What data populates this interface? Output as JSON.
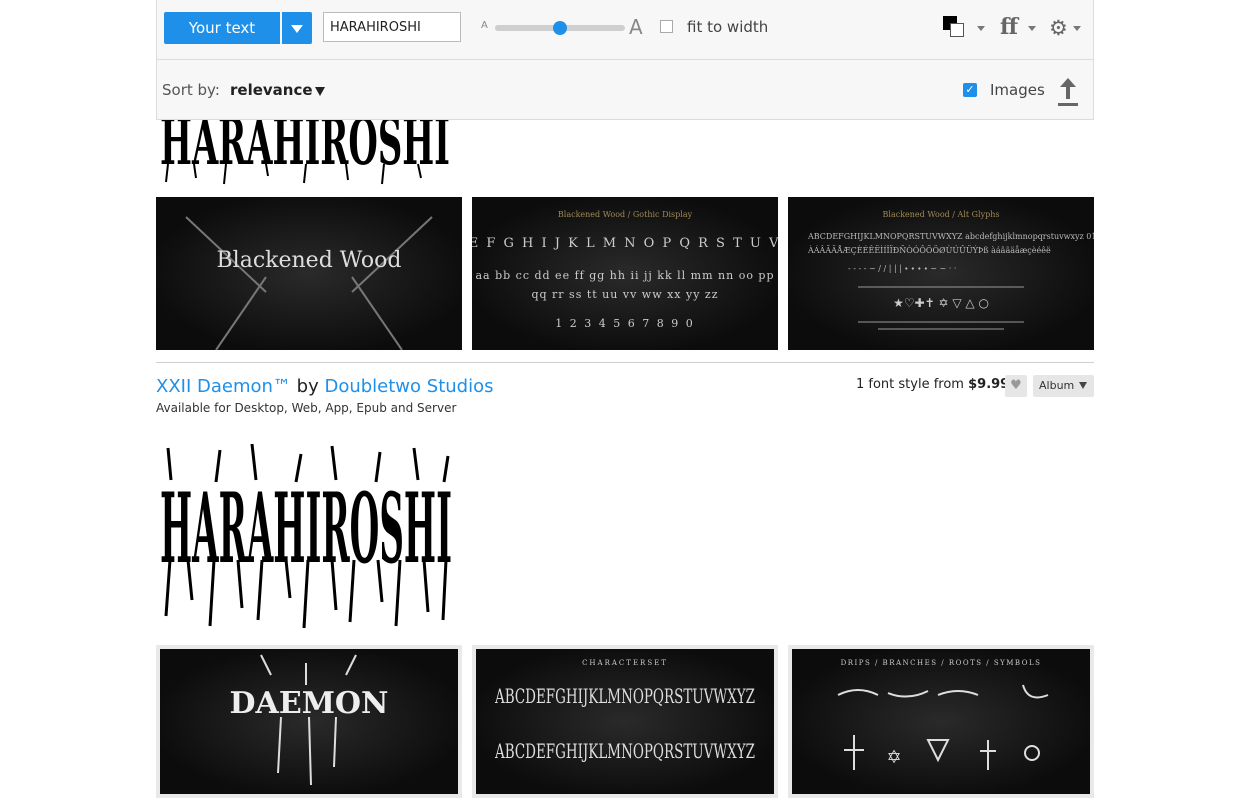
{
  "toolbar": {
    "your_text_label": "Your text",
    "text_value": "HARAHIROSHI",
    "size_small": "A",
    "size_big": "A",
    "size_level": 0.5,
    "fit_to_width_label": "fit to width",
    "fit_to_width_checked": false,
    "sort_label": "Sort by:",
    "sort_value": "relevance",
    "images_label": "Images",
    "images_checked": true
  },
  "previous_font": {
    "sample_text": "HARAHIROSHI",
    "thumbnails": [
      {
        "title": "Blackened Wood",
        "caption": "Blackened Wood"
      },
      {
        "title": "Blackened Wood / Gothic Display",
        "caption": ""
      },
      {
        "title": "Blackened Wood / Alt Glyphs",
        "caption": ""
      }
    ]
  },
  "font": {
    "name": "XXII Daemon™",
    "by": "by",
    "foundry": "Doubletwo Studios",
    "availability": "Available for Desktop, Web, App, Epub and Server",
    "styles_text": "1 font style from",
    "price": "$9.99",
    "album_label": "Album",
    "sample_text": "HARAHIROSHI",
    "thumbnails": [
      {
        "title": "DAEMON",
        "caption": "DAEMON"
      },
      {
        "title": "CHARACTERSET",
        "caption": "CHARACTERSET"
      },
      {
        "title": "DRIPS / BRANCHES / ROOTS / SYMBOLS",
        "caption": "DRIPS / BRANCHES / ROOTS / SYMBOLS"
      }
    ]
  },
  "colors": {
    "accent": "#1e90ea",
    "text": "#222222"
  }
}
